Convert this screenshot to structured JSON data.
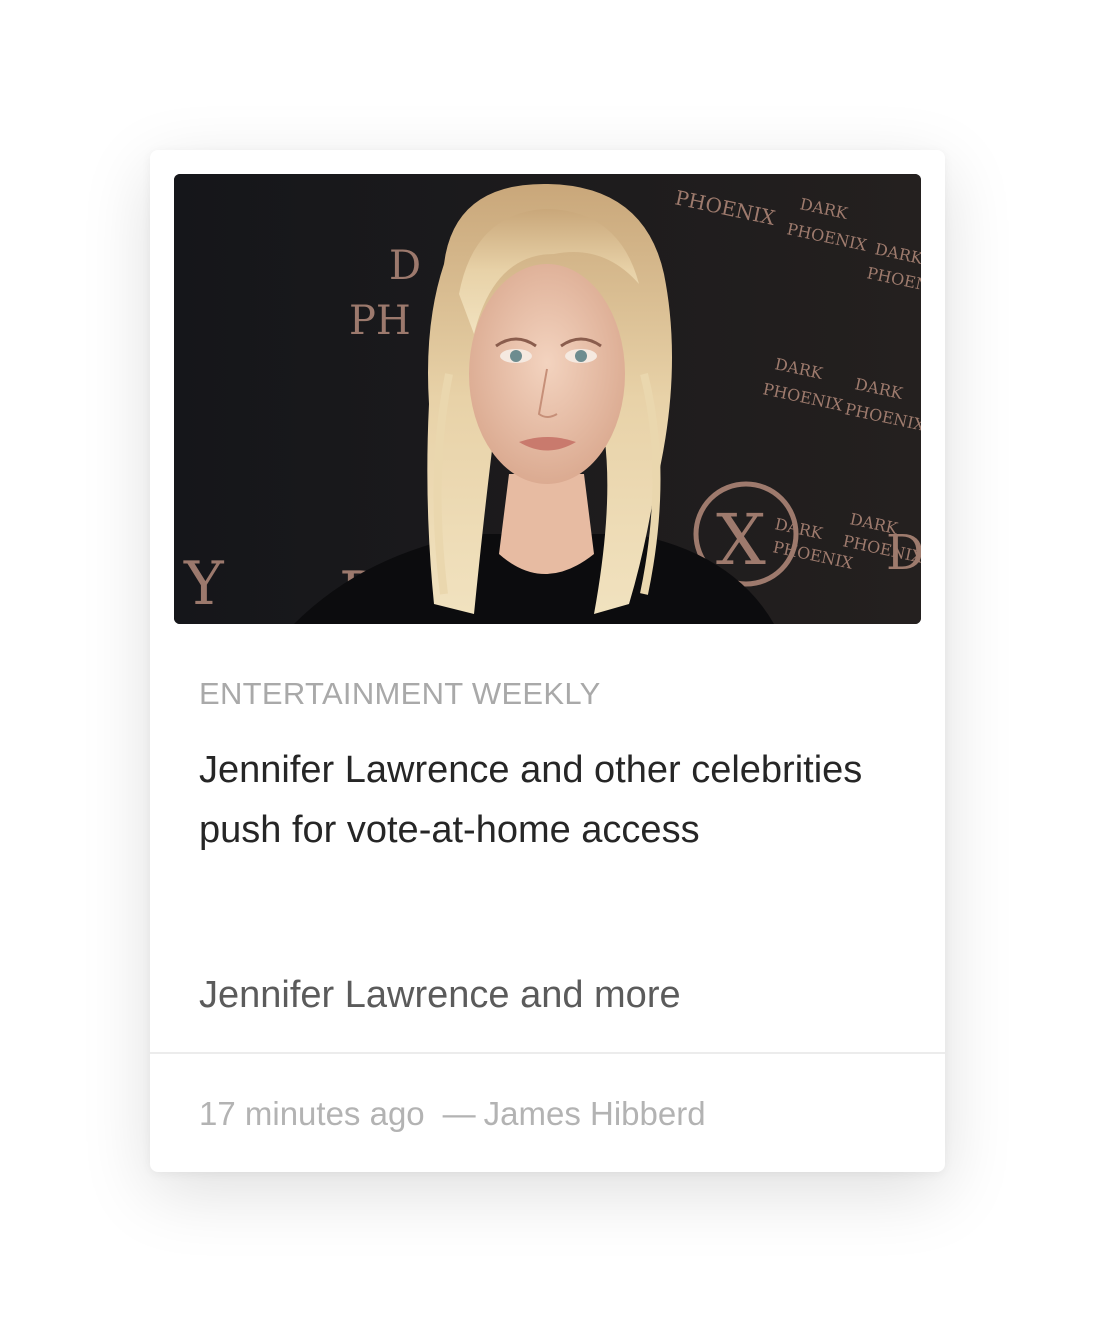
{
  "card": {
    "image": {
      "alt": "Jennifer Lawrence",
      "backdrop_text": [
        "DARK",
        "PHOENIX"
      ]
    },
    "source": "ENTERTAINMENT WEEKLY",
    "headline": "Jennifer Lawrence and other celebrities push for vote-at-home access",
    "summary": "Jennifer Lawrence and more",
    "time": "17 minutes ago",
    "separator": "—",
    "author": "James Hibberd"
  },
  "colors": {
    "background": "#ffffff",
    "source_text": "#a9a9a9",
    "headline_text": "#262626",
    "summary_text": "#5b5b5b",
    "meta_text": "#b3b3b3",
    "divider": "#ececec"
  }
}
